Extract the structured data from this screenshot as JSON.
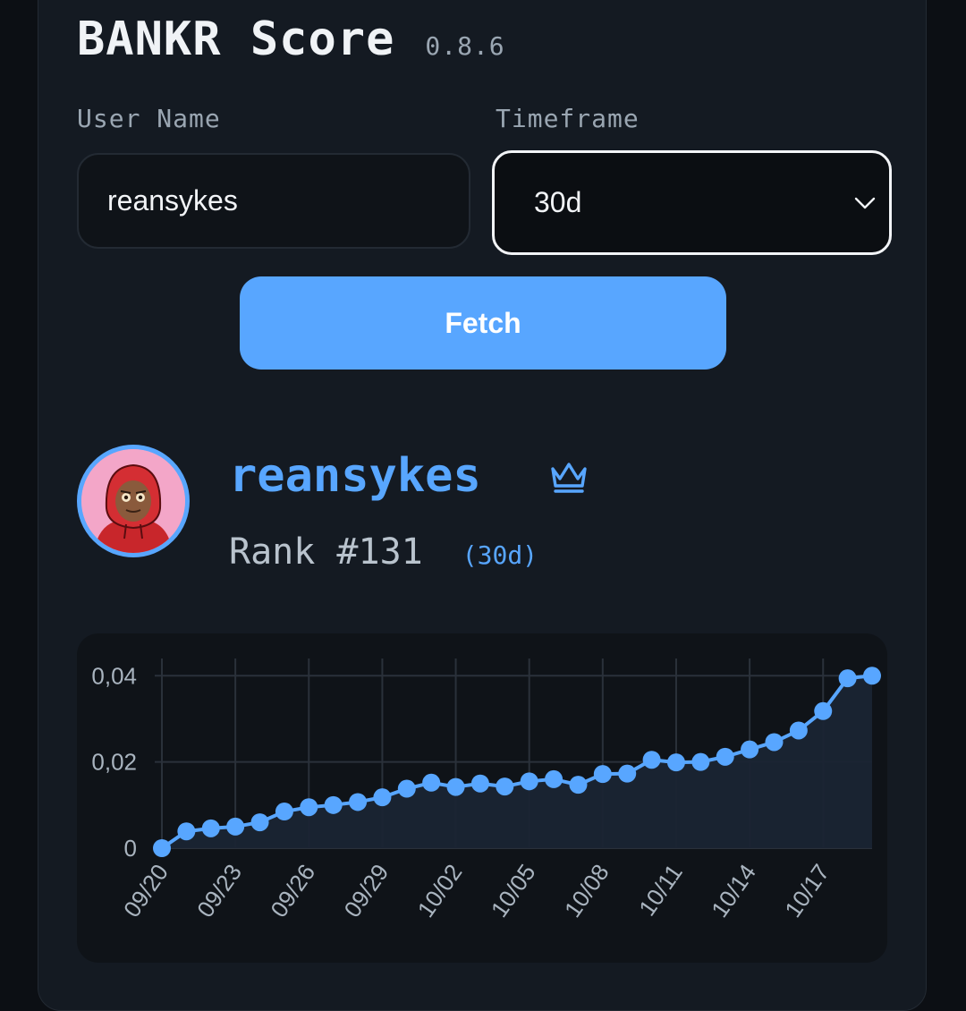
{
  "app": {
    "title": "BANKR Score",
    "version": "0.8.6"
  },
  "form": {
    "user_label": "User Name",
    "user_value": "reansykes",
    "timeframe_label": "Timeframe",
    "timeframe_value": "30d",
    "fetch_label": "Fetch"
  },
  "profile": {
    "username": "reansykes",
    "rank": "Rank #131",
    "timeframe_tag": "(30d)",
    "badge_icon": "crown-icon"
  },
  "colors": {
    "accent": "#58a6ff",
    "background": "#0c0f14",
    "card": "#141a22"
  },
  "chart_data": {
    "type": "area",
    "x": [
      "09/20",
      "09/21",
      "09/22",
      "09/23",
      "09/24",
      "09/25",
      "09/26",
      "09/27",
      "09/28",
      "09/29",
      "09/30",
      "10/01",
      "10/02",
      "10/03",
      "10/04",
      "10/05",
      "10/06",
      "10/07",
      "10/08",
      "10/09",
      "10/10",
      "10/11",
      "10/12",
      "10/13",
      "10/14",
      "10/15",
      "10/16",
      "10/17",
      "10/18",
      "10/19"
    ],
    "values": [
      0,
      0.0039,
      0.0046,
      0.005,
      0.006,
      0.0085,
      0.0095,
      0.01,
      0.0107,
      0.0118,
      0.0138,
      0.0152,
      0.0142,
      0.015,
      0.0143,
      0.0155,
      0.016,
      0.0147,
      0.0172,
      0.0173,
      0.0205,
      0.0199,
      0.02,
      0.0212,
      0.0229,
      0.0246,
      0.0273,
      0.0318,
      0.0394,
      0.04
    ],
    "x_tick_labels": [
      "09/20",
      "09/23",
      "09/26",
      "09/29",
      "10/02",
      "10/05",
      "10/08",
      "10/11",
      "10/14",
      "10/17"
    ],
    "y_tick_labels": [
      "0",
      "0,02",
      "0,04"
    ],
    "y_ticks": [
      0,
      0.02,
      0.04
    ],
    "ylim": [
      0,
      0.044
    ],
    "grid": true,
    "title": "",
    "xlabel": "",
    "ylabel": ""
  }
}
